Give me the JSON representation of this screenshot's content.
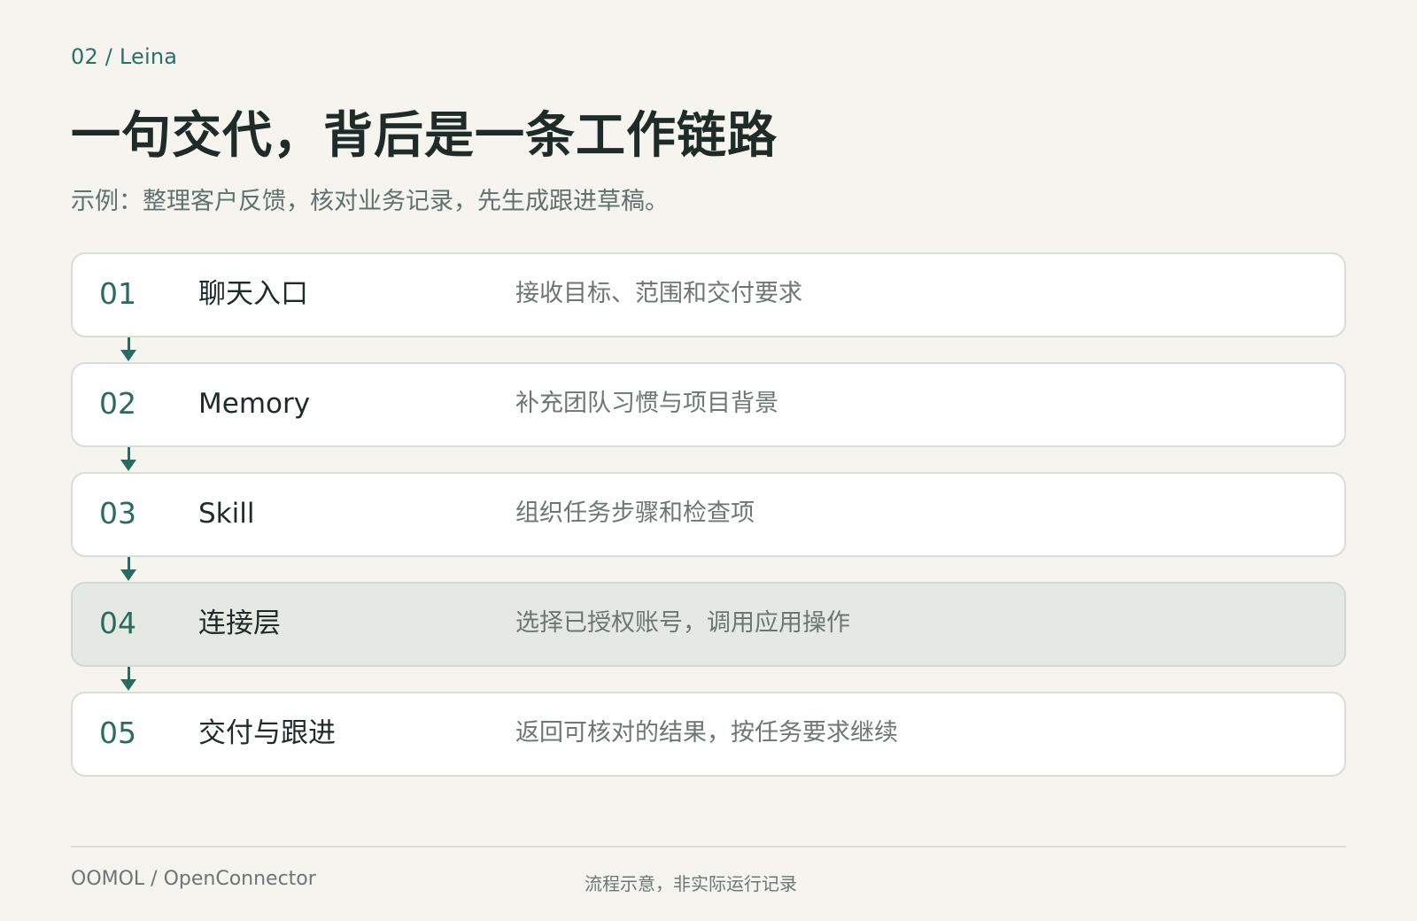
{
  "header": {
    "eyebrow": "02 / Leina",
    "title": "一句交代，背后是一条工作链路",
    "subtitle": "示例：整理客户反馈，核对业务记录，先生成跟进草稿。"
  },
  "steps": [
    {
      "num": "01",
      "name": "聊天入口",
      "desc": "接收目标、范围和交付要求",
      "highlighted": false
    },
    {
      "num": "02",
      "name": "Memory",
      "desc": "补充团队习惯与项目背景",
      "highlighted": false
    },
    {
      "num": "03",
      "name": "Skill",
      "desc": "组织任务步骤和检查项",
      "highlighted": false
    },
    {
      "num": "04",
      "name": "连接层",
      "desc": "选择已授权账号，调用应用操作",
      "highlighted": true
    },
    {
      "num": "05",
      "name": "交付与跟进",
      "desc": "返回可核对的结果，按任务要求继续",
      "highlighted": false
    }
  ],
  "footer": {
    "left": "OOMOL / OpenConnector",
    "center": "流程示意，非实际运行记录"
  },
  "colors": {
    "accent": "#2a6b5f",
    "background": "#f5f4ee",
    "card": "#ffffff",
    "card_highlight": "#e5e9e3"
  }
}
